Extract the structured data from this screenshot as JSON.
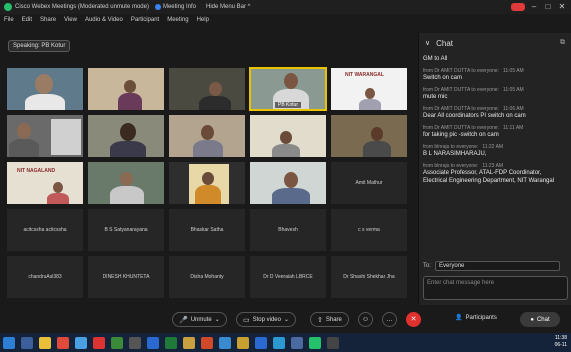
{
  "titlebar": {
    "title": "Cisco Webex Meetings (Moderated unmute mode)",
    "meeting_info": "Meeting Info",
    "hide_menu": "Hide Menu Bar ^"
  },
  "menu": [
    "File",
    "Edit",
    "Share",
    "View",
    "Audio & Video",
    "Participant",
    "Meeting",
    "Help"
  ],
  "speaking": "Speaking: PB Kotur",
  "tiles_video": [
    {
      "label": ""
    },
    {
      "label": ""
    },
    {
      "label": ""
    },
    {
      "label": "PB Kotur"
    },
    {
      "label": ""
    },
    {
      "label": ""
    },
    {
      "label": ""
    },
    {
      "label": ""
    },
    {
      "label": ""
    },
    {
      "label": ""
    },
    {
      "label": ""
    },
    {
      "label": ""
    },
    {
      "label": ""
    },
    {
      "label": ""
    }
  ],
  "signs": {
    "warangal": "NIT WARANGAL",
    "nagaland": "NIT NAGALAND"
  },
  "tiles_names": [
    "Amit Mathur",
    "acitcssha acitcssha",
    "B S Satyanarayana",
    "Bhaskar Satha",
    "Bhavesh",
    "c s verma",
    "chandruAsl383",
    "DINESH KHUNTETA",
    "Disha Mohanty",
    "Dr D Veeraiah LBRCE",
    "Dr Shashi Shekhar Jha"
  ],
  "chat": {
    "header": "Chat",
    "messages": [
      {
        "from": "",
        "time": "",
        "text": "GM to All"
      },
      {
        "from": "from Dr AMIT DUTTA to everyone:",
        "time": "11:05 AM",
        "text": "Switch on cam"
      },
      {
        "from": "from Dr AMIT DUTTA to everyone:",
        "time": "11:05 AM",
        "text": "mute mic"
      },
      {
        "from": "from Dr AMIT DUTTA to everyone:",
        "time": "11:06 AM",
        "text": "Dear All coordinators PI switch on cam"
      },
      {
        "from": "from Dr AMIT DUTTA to everyone:",
        "time": "11:11 AM",
        "text": "for taking pic -switch on cam"
      },
      {
        "from": "from blnraju to everyone:",
        "time": "11:22 AM",
        "text": "B L NARASIMHARAJU,"
      },
      {
        "from": "from blnraju to everyone:",
        "time": "11:23 AM",
        "text": "Associate Professor, ATAL-FDP Coordinator,"
      },
      {
        "from": "",
        "time": "",
        "text": "Electrical Engineering Department, NIT Warangal"
      }
    ],
    "to_label": "To:",
    "to_value": "Everyone",
    "input_placeholder": "Enter chat message here"
  },
  "controls": {
    "unmute": "Unmute",
    "stop_video": "Stop video",
    "share": "Share",
    "participants": "Participants",
    "chat": "Chat"
  },
  "clock": {
    "time": "11:38",
    "date": "06-11"
  }
}
